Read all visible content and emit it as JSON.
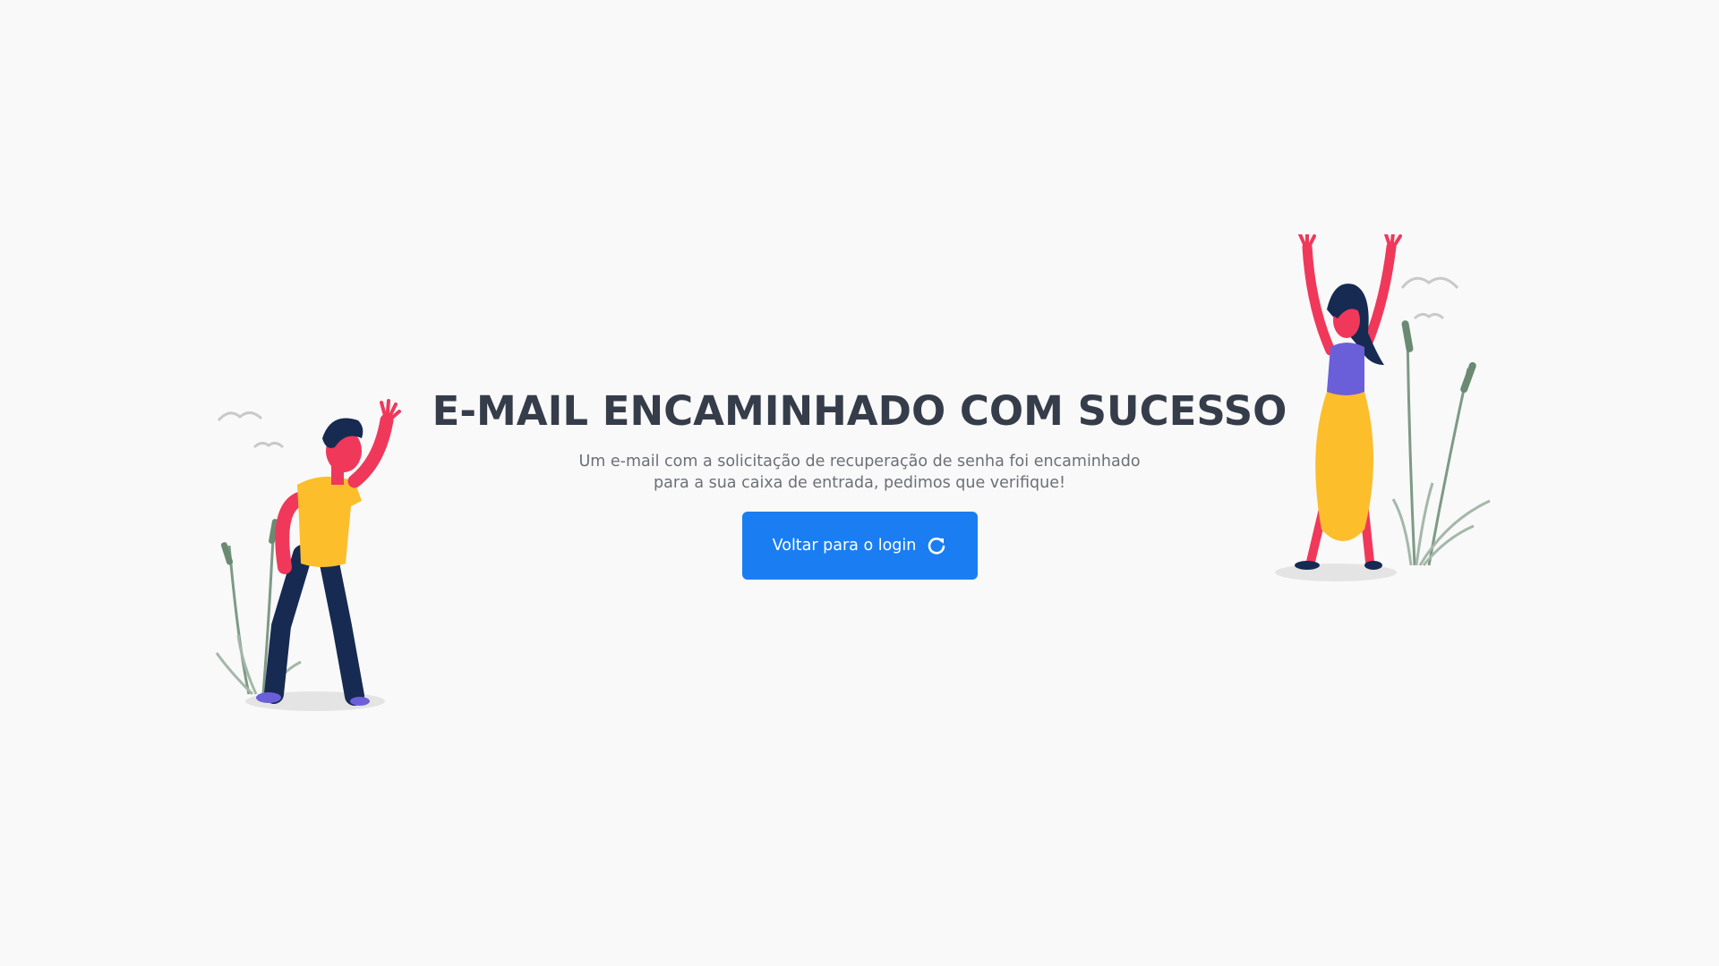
{
  "main": {
    "title": "E-MAIL ENCAMINHADO COM SUCESSO",
    "message": "Um e-mail com a solicitação de recuperação de senha foi encaminhado para a sua caixa de entrada, pedimos que verifique!",
    "button_label": "Voltar para o login",
    "button_icon": "redo-arrow-icon"
  },
  "colors": {
    "background": "#f9f9f9",
    "title": "#353c4a",
    "text": "#6c6f77",
    "button": "#1a7ef2"
  },
  "illustrations": {
    "left": "waving-man-illustration",
    "right": "celebrating-woman-illustration"
  }
}
